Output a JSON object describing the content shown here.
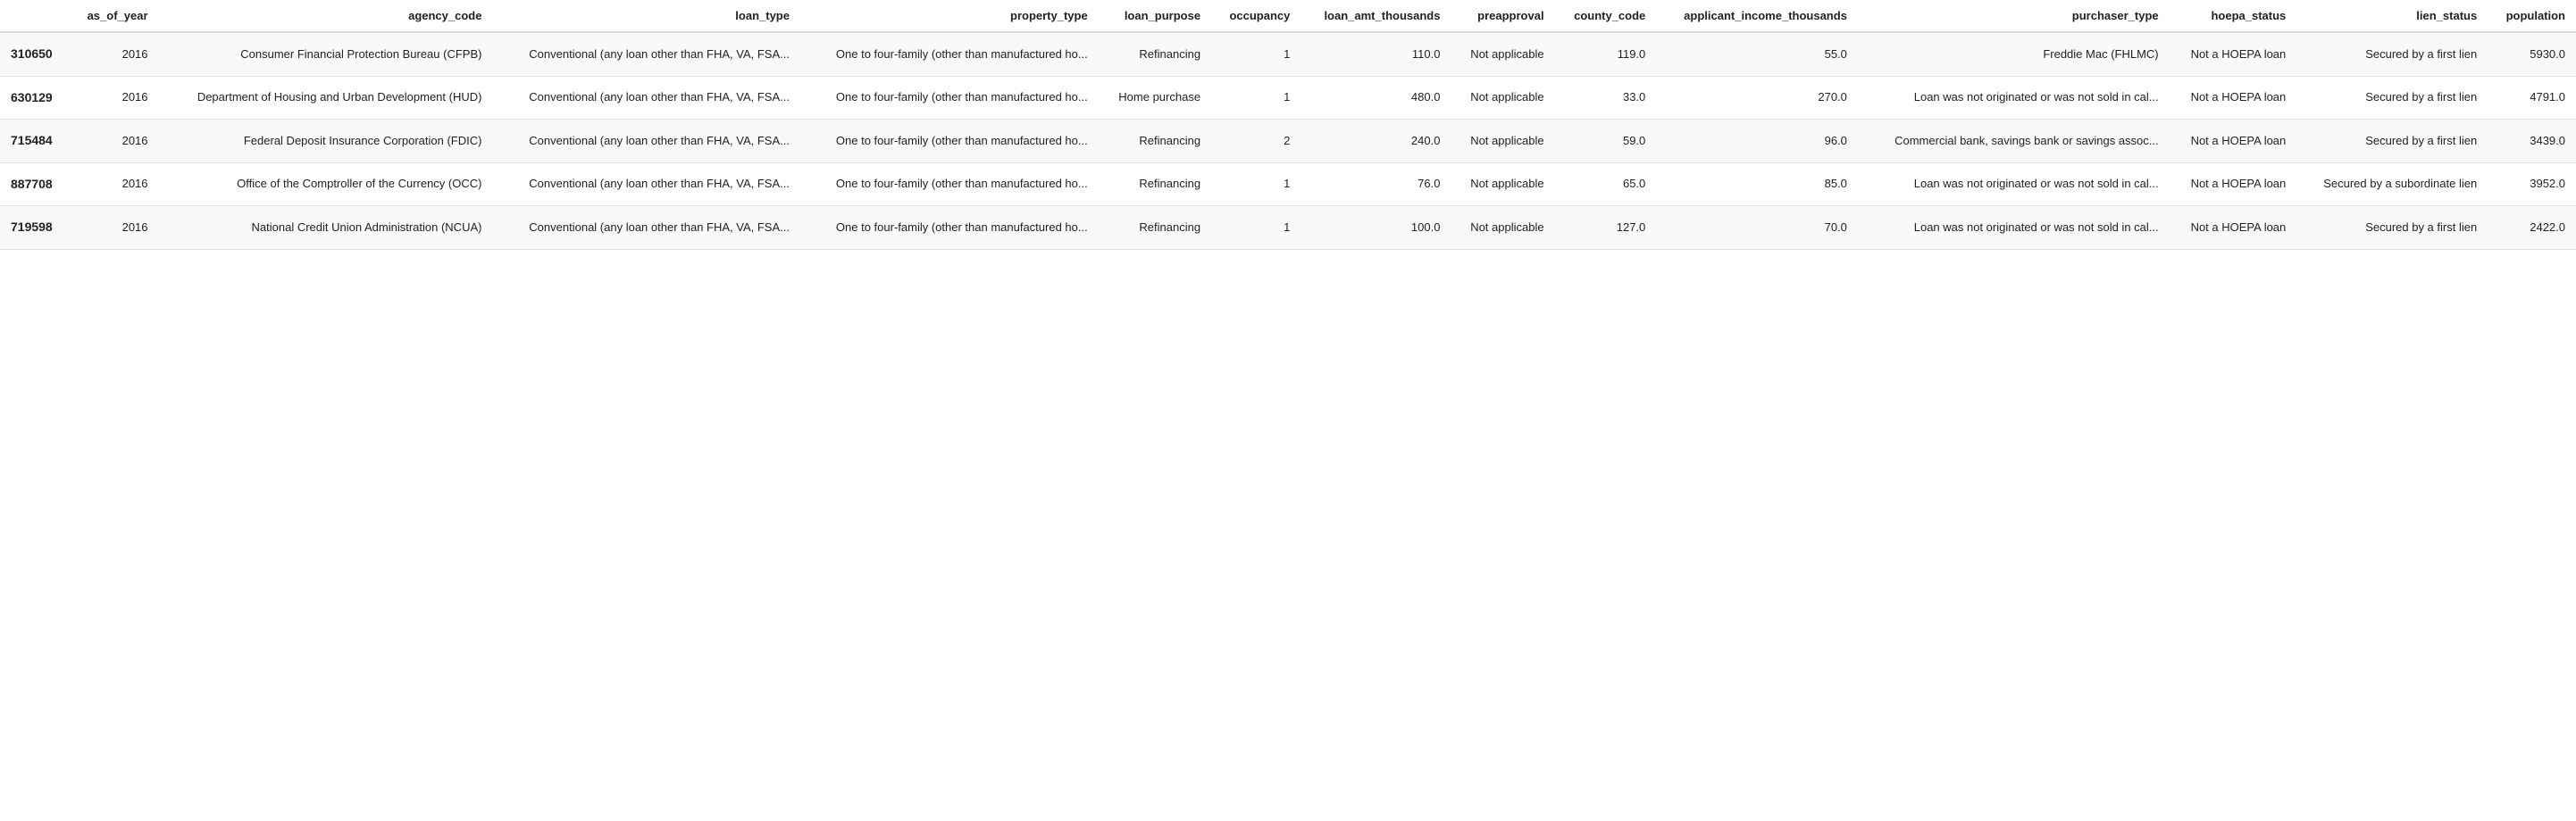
{
  "table": {
    "columns": [
      {
        "key": "row_id",
        "label": ""
      },
      {
        "key": "as_of_year",
        "label": "as_of_year"
      },
      {
        "key": "agency_code",
        "label": "agency_code"
      },
      {
        "key": "loan_type",
        "label": "loan_type"
      },
      {
        "key": "property_type",
        "label": "property_type"
      },
      {
        "key": "loan_purpose",
        "label": "loan_purpose"
      },
      {
        "key": "occupancy",
        "label": "occupancy"
      },
      {
        "key": "loan_amt_thousands",
        "label": "loan_amt_thousands"
      },
      {
        "key": "preapproval",
        "label": "preapproval"
      },
      {
        "key": "county_code",
        "label": "county_code"
      },
      {
        "key": "applicant_income_thousands",
        "label": "applicant_income_thousands"
      },
      {
        "key": "purchaser_type",
        "label": "purchaser_type"
      },
      {
        "key": "hoepa_status",
        "label": "hoepa_status"
      },
      {
        "key": "lien_status",
        "label": "lien_status"
      },
      {
        "key": "population",
        "label": "population"
      }
    ],
    "rows": [
      {
        "row_id": "310650",
        "as_of_year": "2016",
        "agency_code": "Consumer Financial Protection Bureau (CFPB)",
        "loan_type": "Conventional (any loan other than FHA, VA, FSA...",
        "property_type": "One to four-family (other than manufactured ho...",
        "loan_purpose": "Refinancing",
        "occupancy": "1",
        "loan_amt_thousands": "110.0",
        "preapproval": "Not applicable",
        "county_code": "119.0",
        "applicant_income_thousands": "55.0",
        "purchaser_type": "Freddie Mac (FHLMC)",
        "hoepa_status": "Not a HOEPA loan",
        "lien_status": "Secured by a first lien",
        "population": "5930.0"
      },
      {
        "row_id": "630129",
        "as_of_year": "2016",
        "agency_code": "Department of Housing and Urban Development (HUD)",
        "loan_type": "Conventional (any loan other than FHA, VA, FSA...",
        "property_type": "One to four-family (other than manufactured ho...",
        "loan_purpose": "Home purchase",
        "occupancy": "1",
        "loan_amt_thousands": "480.0",
        "preapproval": "Not applicable",
        "county_code": "33.0",
        "applicant_income_thousands": "270.0",
        "purchaser_type": "Loan was not originated or was not sold in cal...",
        "hoepa_status": "Not a HOEPA loan",
        "lien_status": "Secured by a first lien",
        "population": "4791.0"
      },
      {
        "row_id": "715484",
        "as_of_year": "2016",
        "agency_code": "Federal Deposit Insurance Corporation (FDIC)",
        "loan_type": "Conventional (any loan other than FHA, VA, FSA...",
        "property_type": "One to four-family (other than manufactured ho...",
        "loan_purpose": "Refinancing",
        "occupancy": "2",
        "loan_amt_thousands": "240.0",
        "preapproval": "Not applicable",
        "county_code": "59.0",
        "applicant_income_thousands": "96.0",
        "purchaser_type": "Commercial bank, savings bank or savings assoc...",
        "hoepa_status": "Not a HOEPA loan",
        "lien_status": "Secured by a first lien",
        "population": "3439.0"
      },
      {
        "row_id": "887708",
        "as_of_year": "2016",
        "agency_code": "Office of the Comptroller of the Currency (OCC)",
        "loan_type": "Conventional (any loan other than FHA, VA, FSA...",
        "property_type": "One to four-family (other than manufactured ho...",
        "loan_purpose": "Refinancing",
        "occupancy": "1",
        "loan_amt_thousands": "76.0",
        "preapproval": "Not applicable",
        "county_code": "65.0",
        "applicant_income_thousands": "85.0",
        "purchaser_type": "Loan was not originated or was not sold in cal...",
        "hoepa_status": "Not a HOEPA loan",
        "lien_status": "Secured by a subordinate lien",
        "population": "3952.0"
      },
      {
        "row_id": "719598",
        "as_of_year": "2016",
        "agency_code": "National Credit Union Administration (NCUA)",
        "loan_type": "Conventional (any loan other than FHA, VA, FSA...",
        "property_type": "One to four-family (other than manufactured ho...",
        "loan_purpose": "Refinancing",
        "occupancy": "1",
        "loan_amt_thousands": "100.0",
        "preapproval": "Not applicable",
        "county_code": "127.0",
        "applicant_income_thousands": "70.0",
        "purchaser_type": "Loan was not originated or was not sold in cal...",
        "hoepa_status": "Not a HOEPA loan",
        "lien_status": "Secured by a first lien",
        "population": "2422.0"
      }
    ]
  }
}
